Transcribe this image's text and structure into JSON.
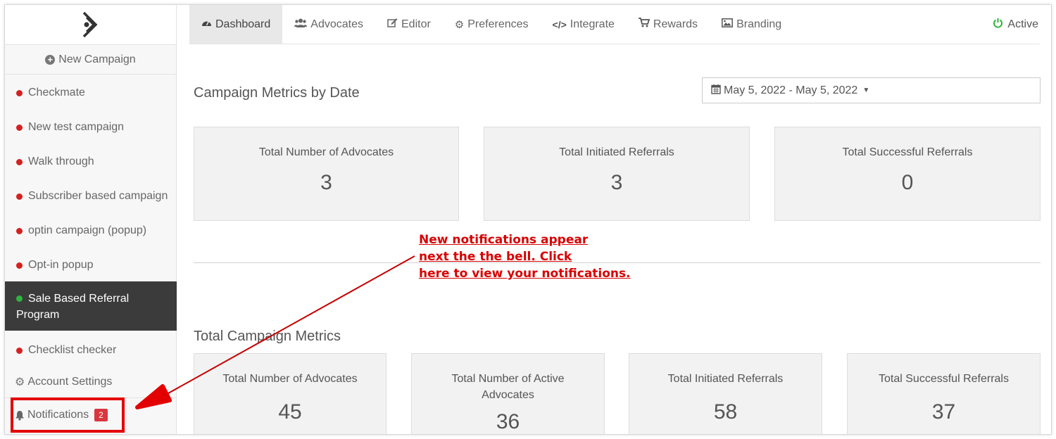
{
  "sidebar": {
    "new_campaign": "New Campaign",
    "campaigns": [
      {
        "label": "Checkmate",
        "status": "red"
      },
      {
        "label": "New test campaign",
        "status": "red"
      },
      {
        "label": "Walk through",
        "status": "red"
      },
      {
        "label": "Subscriber based campaign",
        "status": "red"
      },
      {
        "label": "optin campaign (popup)",
        "status": "red"
      },
      {
        "label": "Opt-in popup",
        "status": "red"
      },
      {
        "label_line1": "Sale Based Referral",
        "label_line2": "Program",
        "status": "green",
        "selected": true
      },
      {
        "label": "Checklist checker",
        "status": "red"
      }
    ],
    "account_settings": "Account Settings",
    "notifications": "Notifications",
    "notification_count": "2"
  },
  "nav": {
    "tabs": [
      {
        "label": "Dashboard",
        "icon": "dashboard-icon"
      },
      {
        "label": "Advocates",
        "icon": "users-icon"
      },
      {
        "label": "Editor",
        "icon": "edit-icon"
      },
      {
        "label": "Preferences",
        "icon": "cogs-icon"
      },
      {
        "label": "Integrate",
        "icon": "code-icon"
      },
      {
        "label": "Rewards",
        "icon": "cart-icon"
      },
      {
        "label": "Branding",
        "icon": "image-icon"
      }
    ],
    "status": "Active"
  },
  "metrics_by_date": {
    "title": "Campaign Metrics by Date",
    "date_range": "May 5, 2022 - May 5, 2022",
    "cards": [
      {
        "label": "Total Number of Advocates",
        "value": "3"
      },
      {
        "label": "Total Initiated Referrals",
        "value": "3"
      },
      {
        "label": "Total Successful Referrals",
        "value": "0"
      }
    ]
  },
  "total_metrics": {
    "title": "Total Campaign Metrics",
    "cards": [
      {
        "label": "Total Number of Advocates",
        "value": "45"
      },
      {
        "label_line1": "Total Number of Active",
        "label_line2": "Advocates",
        "value": "36"
      },
      {
        "label": "Total Initiated Referrals",
        "value": "58"
      },
      {
        "label": "Total Successful Referrals",
        "value": "37"
      }
    ]
  },
  "annotation": {
    "line1": "New notifications appear",
    "line2": "next the the bell. Click",
    "line3": "here to view your notifications."
  },
  "colors": {
    "accent_red": "#e30000",
    "active_green": "#2fb43c",
    "sidebar_selected": "#3b3b3b"
  }
}
